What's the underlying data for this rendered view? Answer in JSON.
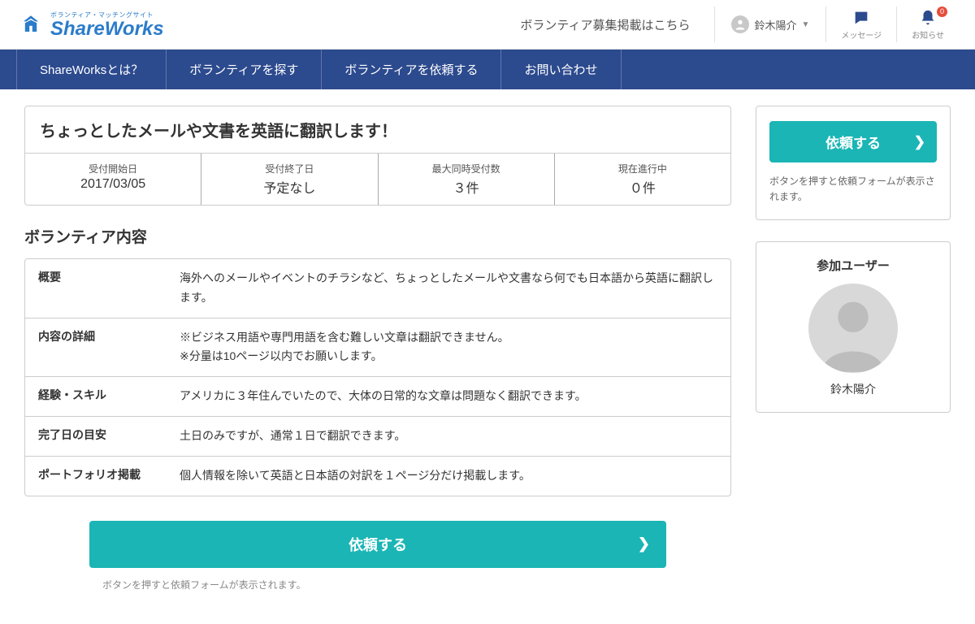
{
  "header": {
    "logo_sub": "ボランティア・マッチングサイト",
    "logo_main": "ShareWorks",
    "recruit_link": "ボランティア募集掲載はこちら",
    "username": "鈴木陽介",
    "message_label": "メッセージ",
    "notification_label": "お知らせ",
    "notification_count": "0"
  },
  "nav": {
    "items": [
      "ShareWorksとは？",
      "ボランティアを探す",
      "ボランティアを依頼する",
      "お問い合わせ"
    ]
  },
  "listing": {
    "title": "ちょっとしたメールや文書を英語に翻訳します！",
    "stats": [
      {
        "label": "受付開始日",
        "value": "2017/03/05"
      },
      {
        "label": "受付終了日",
        "value": "予定なし"
      },
      {
        "label": "最大同時受付数",
        "value": "３件"
      },
      {
        "label": "現在進行中",
        "value": "０件"
      }
    ]
  },
  "content": {
    "section_title": "ボランティア内容",
    "rows": [
      {
        "label": "概要",
        "value": "海外へのメールやイベントのチラシなど、ちょっとしたメールや文書なら何でも日本語から英語に翻訳します。"
      },
      {
        "label": "内容の詳細",
        "value": "※ビジネス用語や専門用語を含む難しい文章は翻訳できません。\n※分量は10ページ以内でお願いします。"
      },
      {
        "label": "経験・スキル",
        "value": "アメリカに３年住んでいたので、大体の日常的な文章は問題なく翻訳できます。"
      },
      {
        "label": "完了日の目安",
        "value": "土日のみですが、通常１日で翻訳できます。"
      },
      {
        "label": "ポートフォリオ掲載",
        "value": "個人情報を除いて英語と日本語の対訳を１ページ分だけ掲載します。"
      }
    ]
  },
  "cta": {
    "button": "依頼する",
    "note": "ボタンを押すと依頼フォームが表示されます。"
  },
  "sidebar": {
    "request_button": "依頼する",
    "request_note": "ボタンを押すと依頼フォームが表示されます。",
    "participant_title": "参加ユーザー",
    "participant_name": "鈴木陽介"
  }
}
